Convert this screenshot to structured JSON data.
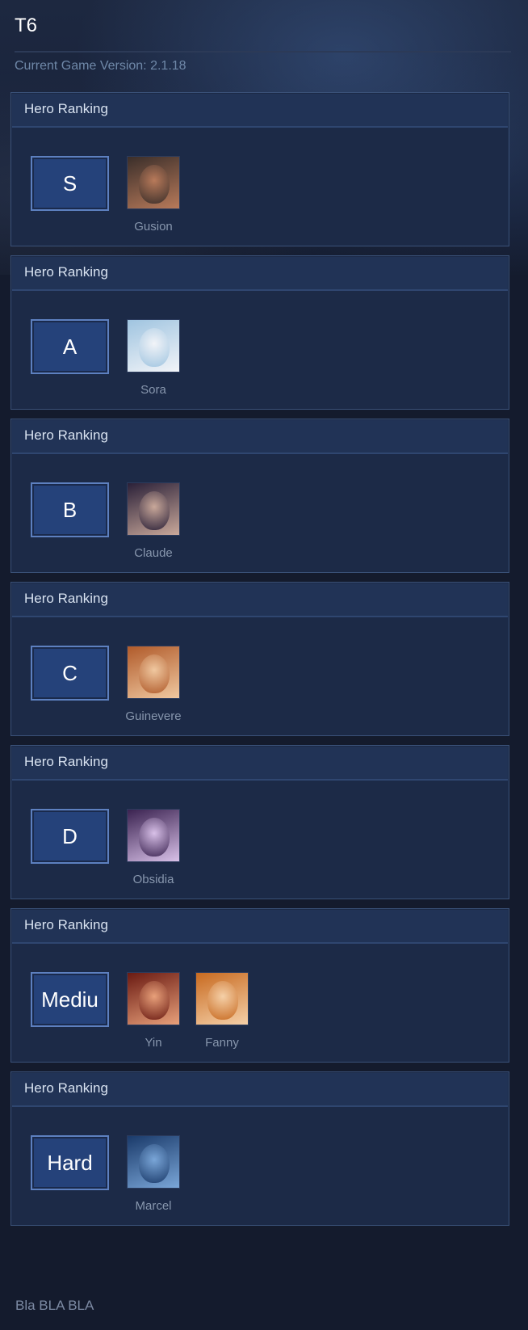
{
  "page": {
    "title": "T6",
    "version": "Current Game Version: 2.1.18",
    "footer": "Bla BLA BLA"
  },
  "card_header": "Hero Ranking",
  "tiers": [
    {
      "label": "S",
      "heroes": [
        {
          "name": "Gusion",
          "colors": [
            "#3a2e2a",
            "#b87a5a"
          ]
        }
      ]
    },
    {
      "label": "A",
      "heroes": [
        {
          "name": "Sora",
          "colors": [
            "#9fc4e0",
            "#f2f4f8"
          ]
        }
      ]
    },
    {
      "label": "B",
      "heroes": [
        {
          "name": "Claude",
          "colors": [
            "#2a2038",
            "#c9a89a"
          ]
        }
      ]
    },
    {
      "label": "C",
      "heroes": [
        {
          "name": "Guinevere",
          "colors": [
            "#b05a2a",
            "#f0c8a0"
          ]
        }
      ]
    },
    {
      "label": "D",
      "heroes": [
        {
          "name": "Obsidia",
          "colors": [
            "#3a2250",
            "#d8c0e8"
          ]
        }
      ]
    },
    {
      "label": "Mediu",
      "heroes": [
        {
          "name": "Yin",
          "colors": [
            "#6a1a12",
            "#e8a07a"
          ]
        },
        {
          "name": "Fanny",
          "colors": [
            "#c86a20",
            "#f5d0a8"
          ]
        }
      ]
    },
    {
      "label": "Hard",
      "heroes": [
        {
          "name": "Marcel",
          "colors": [
            "#1a3a6a",
            "#7aa6d8"
          ]
        }
      ]
    }
  ]
}
